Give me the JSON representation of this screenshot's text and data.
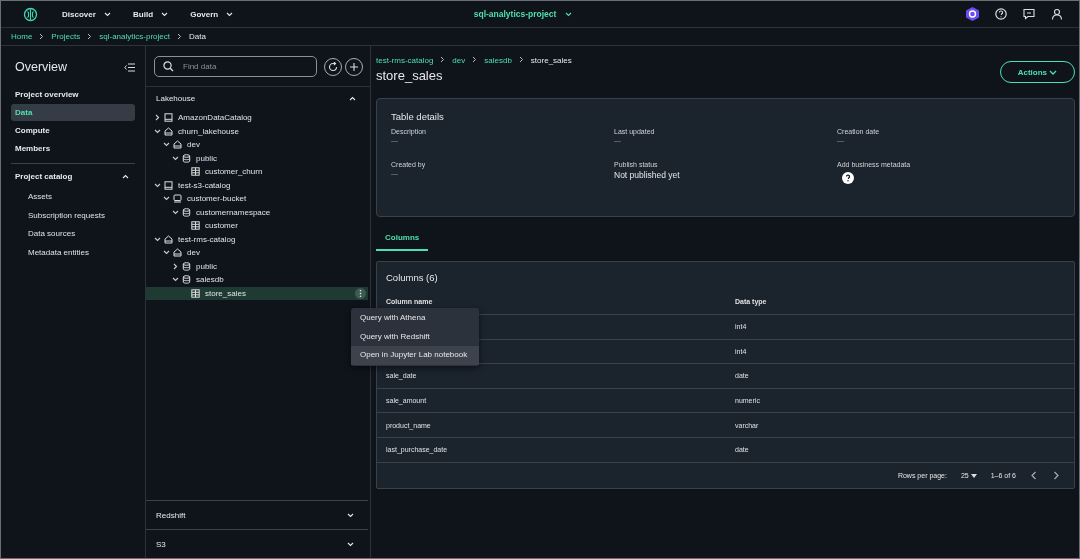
{
  "topbar": {
    "menus": [
      {
        "label": "Discover"
      },
      {
        "label": "Build"
      },
      {
        "label": "Govern"
      }
    ],
    "project": "sql-analytics-project"
  },
  "breadcrumb": [
    {
      "label": "Home",
      "link": true
    },
    {
      "label": "Projects",
      "link": true
    },
    {
      "label": "sql-analytics-project",
      "link": true
    },
    {
      "label": "Data",
      "link": false
    }
  ],
  "sidebar": {
    "title": "Overview",
    "items": [
      {
        "label": "Project overview",
        "selected": false
      },
      {
        "label": "Data",
        "selected": true
      },
      {
        "label": "Compute",
        "selected": false
      },
      {
        "label": "Members",
        "selected": false
      }
    ],
    "catalog": {
      "label": "Project catalog",
      "expanded": true,
      "items": [
        {
          "label": "Assets"
        },
        {
          "label": "Subscription requests"
        },
        {
          "label": "Data sources"
        },
        {
          "label": "Metadata entities"
        }
      ]
    }
  },
  "explorer": {
    "search": {
      "placeholder": "Find data"
    },
    "sections": [
      {
        "label": "Lakehouse",
        "expanded": true,
        "tree": [
          {
            "label": "AmazonDataCatalog",
            "kind": "catalog",
            "expanded": false,
            "selected": false
          },
          {
            "label": "churn_lakehouse",
            "kind": "lakehouse",
            "expanded": true,
            "selected": false,
            "children": [
              {
                "label": "dev",
                "kind": "lakehouse",
                "expanded": true,
                "selected": false,
                "children": [
                  {
                    "label": "public",
                    "kind": "database",
                    "expanded": true,
                    "selected": false,
                    "children": [
                      {
                        "label": "customer_churn",
                        "kind": "table",
                        "selected": false
                      }
                    ]
                  }
                ]
              }
            ]
          },
          {
            "label": "test-s3-catalog",
            "kind": "catalog",
            "expanded": true,
            "selected": false,
            "children": [
              {
                "label": "customer-bucket",
                "kind": "bucket",
                "expanded": true,
                "selected": false,
                "children": [
                  {
                    "label": "customernamespace",
                    "kind": "database",
                    "expanded": true,
                    "selected": false,
                    "children": [
                      {
                        "label": "customer",
                        "kind": "table",
                        "selected": false
                      }
                    ]
                  }
                ]
              }
            ]
          },
          {
            "label": "test-rms-catalog",
            "kind": "lakehouse",
            "expanded": true,
            "selected": false,
            "children": [
              {
                "label": "dev",
                "kind": "lakehouse",
                "expanded": true,
                "selected": false,
                "children": [
                  {
                    "label": "public",
                    "kind": "database",
                    "expanded": false,
                    "selected": false
                  },
                  {
                    "label": "salesdb",
                    "kind": "database",
                    "expanded": true,
                    "selected": false,
                    "children": [
                      {
                        "label": "store_sales",
                        "kind": "table",
                        "selected": true
                      }
                    ]
                  }
                ]
              }
            ]
          }
        ]
      },
      {
        "label": "Redshift",
        "expanded": false
      },
      {
        "label": "S3",
        "expanded": false
      }
    ]
  },
  "context_menu": {
    "items": [
      {
        "label": "Query with Athena",
        "selected": false
      },
      {
        "label": "Query with Redshift",
        "selected": false
      },
      {
        "label": "Open in Jupyter Lab notebook",
        "selected": true
      }
    ]
  },
  "details": {
    "path": [
      {
        "label": "test-rms-catalog",
        "link": true
      },
      {
        "label": "dev",
        "link": true
      },
      {
        "label": "salesdb",
        "link": true
      },
      {
        "label": "store_sales",
        "link": false
      }
    ],
    "title": "store_sales",
    "actions": "Actions",
    "card_title": "Table details",
    "fields": [
      {
        "label": "Description",
        "kind": "empty",
        "value": "—"
      },
      {
        "label": "Last updated",
        "kind": "empty",
        "value": "—"
      },
      {
        "label": "Creation date",
        "kind": "empty",
        "value": "—"
      },
      {
        "label": "Created by",
        "kind": "empty",
        "value": "—"
      },
      {
        "label": "Publish status",
        "kind": "text",
        "value": "Not published yet"
      },
      {
        "label": "Add business metadata",
        "kind": "help"
      }
    ]
  },
  "tabs": [
    {
      "label": "Columns",
      "selected": true
    }
  ],
  "columns_table": {
    "title": "Columns (6)",
    "columns": [
      "Column name",
      "Data type"
    ],
    "rows": [
      {
        "data_type": "int4"
      },
      {
        "data_type": "int4"
      },
      {
        "column_name": "sale_date",
        "data_type": "date"
      },
      {
        "column_name": "sale_amount",
        "data_type": "numeric"
      },
      {
        "column_name": "product_name",
        "data_type": "varchar"
      },
      {
        "column_name": "last_purchase_date",
        "data_type": "date"
      }
    ],
    "pagination": {
      "label": "Rows per page:",
      "size": "25",
      "range": "1–6 of 6"
    }
  }
}
